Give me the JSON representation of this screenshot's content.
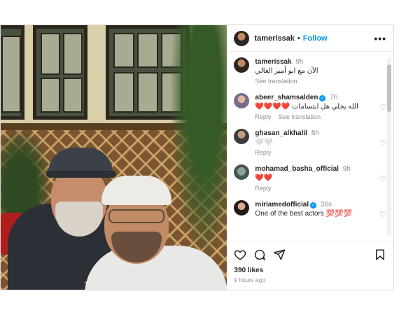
{
  "post": {
    "username": "tamerissak",
    "follow_label": "Follow",
    "more_label": "•••",
    "dot": "•"
  },
  "comments": [
    {
      "user": "tamerissak",
      "time": "9h",
      "text": "الآن مع ابو أمير الغالي",
      "reply": "",
      "translate": "See translation",
      "verified": false
    },
    {
      "user": "abeer_shamsalden",
      "time": "7h",
      "text": "الله يخلي هل ابتسامات ❤️❤️❤️❤️",
      "reply": "Reply",
      "translate": "See translation",
      "verified": true
    },
    {
      "user": "ghasan_alkhalil",
      "time": "8h",
      "text": "🤍🤍",
      "reply": "Reply",
      "translate": "",
      "verified": false
    },
    {
      "user": "mohamad_basha_official",
      "time": "9h",
      "text": "❤️❤️",
      "reply": "Reply",
      "translate": "",
      "verified": false
    },
    {
      "user": "miriamedofficial",
      "time": "36s",
      "text": "One of the best actors 💯💯💯",
      "reply": "",
      "translate": "",
      "verified": true
    }
  ],
  "footer": {
    "likes": "390 likes",
    "ago": "9 hours ago"
  },
  "icons": {
    "like": "heart-icon",
    "comment": "comment-icon",
    "share": "share-icon",
    "save": "bookmark-icon",
    "comment_like": "heart-outline-icon",
    "verified": "verified-badge-icon"
  },
  "colors": {
    "accent": "#0095f6",
    "heart_red": "#e0245e"
  }
}
